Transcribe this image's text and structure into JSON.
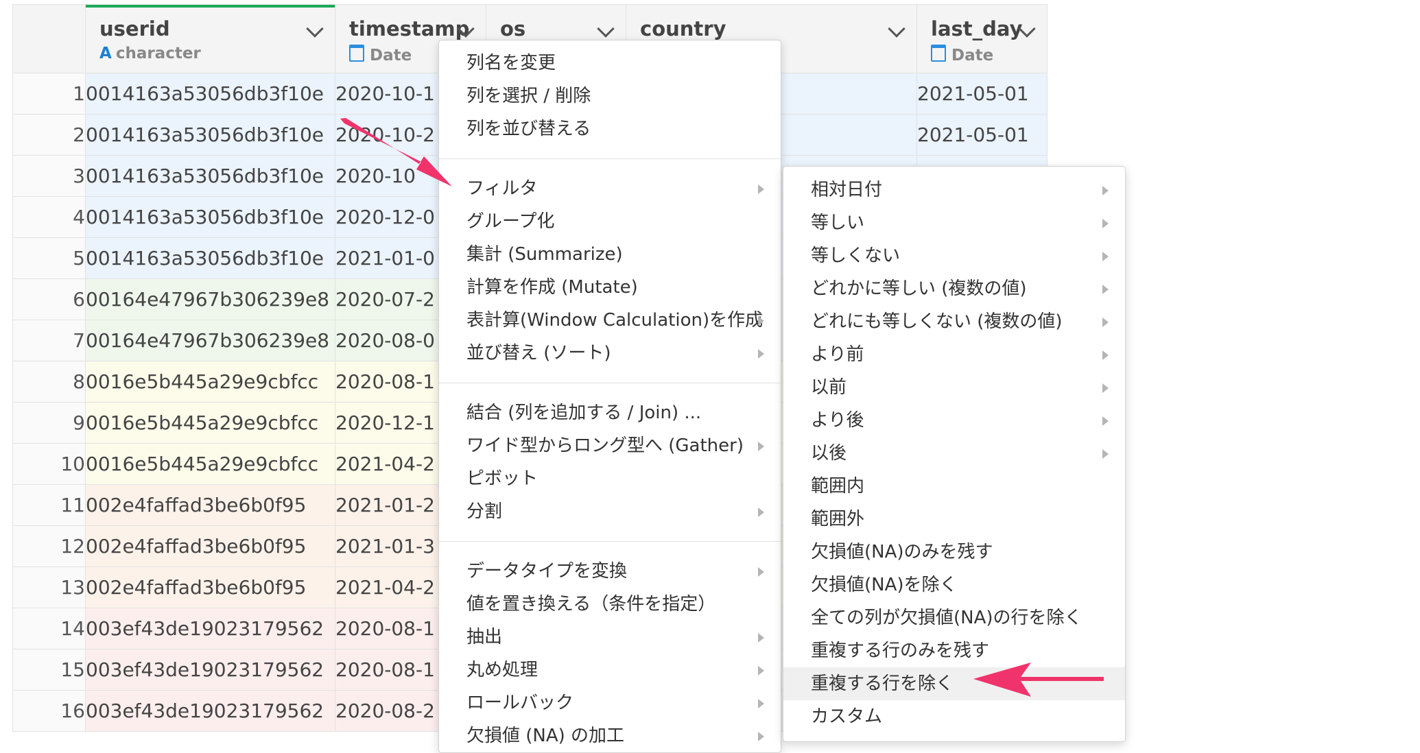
{
  "columns": [
    {
      "name": "userid",
      "type": "character",
      "icon": "character-type-icon"
    },
    {
      "name": "timestamp",
      "type": "Date",
      "icon": "date-type-icon"
    },
    {
      "name": "os",
      "type": "",
      "icon": ""
    },
    {
      "name": "country",
      "type": "",
      "icon": ""
    },
    {
      "name": "last_day",
      "type": "Date",
      "icon": "date-type-icon"
    }
  ],
  "rows": [
    {
      "n": "1",
      "userid": "0014163a53056db3f10e",
      "ts": "2020-10-1",
      "last": "2021-05-01"
    },
    {
      "n": "2",
      "userid": "0014163a53056db3f10e",
      "ts": "2020-10-2",
      "last": "2021-05-01"
    },
    {
      "n": "3",
      "userid": "0014163a53056db3f10e",
      "ts": "2020-10",
      "last": ""
    },
    {
      "n": "4",
      "userid": "0014163a53056db3f10e",
      "ts": "2020-12-0",
      "last": ""
    },
    {
      "n": "5",
      "userid": "0014163a53056db3f10e",
      "ts": "2021-01-0",
      "last": ""
    },
    {
      "n": "6",
      "userid": "00164e47967b306239e8",
      "ts": "2020-07-2",
      "last": ""
    },
    {
      "n": "7",
      "userid": "00164e47967b306239e8",
      "ts": "2020-08-0",
      "last": ""
    },
    {
      "n": "8",
      "userid": "0016e5b445a29e9cbfcc",
      "ts": "2020-08-1",
      "last": ""
    },
    {
      "n": "9",
      "userid": "0016e5b445a29e9cbfcc",
      "ts": "2020-12-1",
      "last": ""
    },
    {
      "n": "10",
      "userid": "0016e5b445a29e9cbfcc",
      "ts": "2021-04-2",
      "last": ""
    },
    {
      "n": "11",
      "userid": "002e4faffad3be6b0f95",
      "ts": "2021-01-2",
      "last": ""
    },
    {
      "n": "12",
      "userid": "002e4faffad3be6b0f95",
      "ts": "2021-01-3",
      "last": ""
    },
    {
      "n": "13",
      "userid": "002e4faffad3be6b0f95",
      "ts": "2021-04-2",
      "last": ""
    },
    {
      "n": "14",
      "userid": "003ef43de19023179562",
      "ts": "2020-08-1",
      "last": ""
    },
    {
      "n": "15",
      "userid": "003ef43de19023179562",
      "ts": "2020-08-1",
      "last": ""
    },
    {
      "n": "16",
      "userid": "003ef43de19023179562",
      "ts": "2020-08-2",
      "last": ""
    }
  ],
  "row_colors": [
    "#ebf3fc",
    "#ebf3fc",
    "#ebf3fc",
    "#ebf3fc",
    "#ebf3fc",
    "#eff7ec",
    "#eff7ec",
    "#fdfbea",
    "#fdfbea",
    "#fdfbea",
    "#fdf2ea",
    "#fdf2ea",
    "#fdf2ea",
    "#fdeeee",
    "#fdeeee",
    "#fdeeee"
  ],
  "menu_main": [
    {
      "label": "列名を変更",
      "sub": false
    },
    {
      "label": "列を選択 / 削除",
      "sub": false
    },
    {
      "label": "列を並び替える",
      "sub": false
    },
    {
      "sep": true
    },
    {
      "label": "フィルタ",
      "sub": true
    },
    {
      "label": "グループ化",
      "sub": false
    },
    {
      "label": "集計 (Summarize)",
      "sub": false
    },
    {
      "label": "計算を作成 (Mutate)",
      "sub": false
    },
    {
      "label": "表計算(Window Calculation)を作成",
      "sub": true
    },
    {
      "label": "並び替え (ソート)",
      "sub": true
    },
    {
      "sep": true
    },
    {
      "label": "結合 (列を追加する / Join) ...",
      "sub": false
    },
    {
      "label": "ワイド型からロング型へ (Gather)",
      "sub": true
    },
    {
      "label": "ピボット",
      "sub": false
    },
    {
      "label": "分割",
      "sub": true
    },
    {
      "sep": true
    },
    {
      "label": "データタイプを変換",
      "sub": true
    },
    {
      "label": "値を置き換える（条件を指定）",
      "sub": false
    },
    {
      "label": "抽出",
      "sub": true
    },
    {
      "label": "丸め処理",
      "sub": true
    },
    {
      "label": "ロールバック",
      "sub": true
    },
    {
      "label": "欠損値 (NA) の加工",
      "sub": true
    }
  ],
  "menu_filter": [
    {
      "label": "相対日付",
      "sub": true
    },
    {
      "label": "等しい",
      "sub": true
    },
    {
      "label": "等しくない",
      "sub": true
    },
    {
      "label": "どれかに等しい (複数の値)",
      "sub": true
    },
    {
      "label": "どれにも等しくない (複数の値)",
      "sub": true
    },
    {
      "label": "より前",
      "sub": true
    },
    {
      "label": "以前",
      "sub": true
    },
    {
      "label": "より後",
      "sub": true
    },
    {
      "label": "以後",
      "sub": true
    },
    {
      "label": "範囲内",
      "sub": false
    },
    {
      "label": "範囲外",
      "sub": false
    },
    {
      "label": "欠損値(NA)のみを残す",
      "sub": false
    },
    {
      "label": "欠損値(NA)を除く",
      "sub": false
    },
    {
      "label": "全ての列が欠損値(NA)の行を除く",
      "sub": false
    },
    {
      "label": "重複する行のみを残す",
      "sub": false
    },
    {
      "label": "重複する行を除く",
      "sub": false,
      "highlight": true
    },
    {
      "label": "カスタム",
      "sub": false
    }
  ],
  "annotation_color": "#f0336b"
}
